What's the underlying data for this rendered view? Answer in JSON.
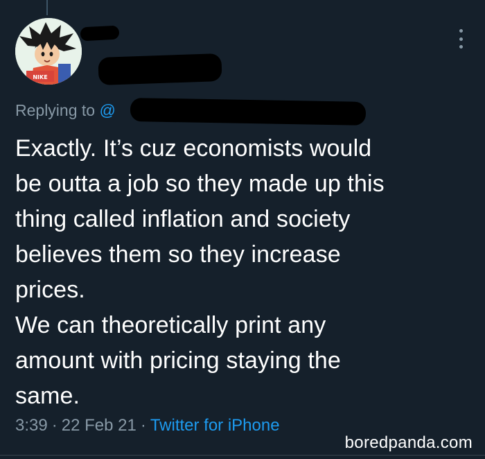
{
  "tweet": {
    "replying_prefix": "Replying to ",
    "mention_visible": "@",
    "text": "Exactly. It’s cuz economists would\nbe outta a job so they made up this\nthing called inflation and society\nbelieves them so they increase\nprices.\nWe can theoretically print any\namount with pricing staying the\nsame.",
    "time": "3:39",
    "separator": "·",
    "date": "22 Feb 21",
    "source": "Twitter for iPhone"
  },
  "watermark": "boredpanda.com",
  "avatar_label": "NIKE",
  "icons": {
    "more": "more-vertical-icon"
  },
  "colors": {
    "background": "#15202b",
    "text": "#ffffff",
    "secondary_text": "#8899a6",
    "link": "#1d9bf0",
    "redaction": "#000000"
  }
}
